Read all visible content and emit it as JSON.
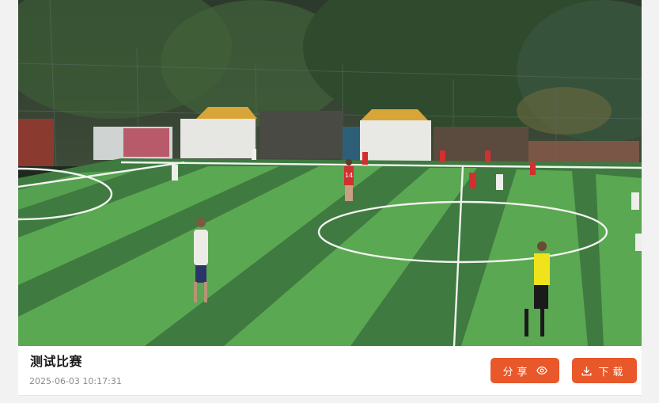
{
  "video": {
    "description_icon": "video-frame"
  },
  "match": {
    "title": "测试比赛",
    "timestamp": "2025-06-03 10:17:31"
  },
  "actions": {
    "share_label": "分享",
    "share_icon": "eye-icon",
    "download_label": "下载",
    "download_icon": "download-icon",
    "accent_color": "#e8582a"
  },
  "player_numbers": {
    "red_player": "14"
  }
}
